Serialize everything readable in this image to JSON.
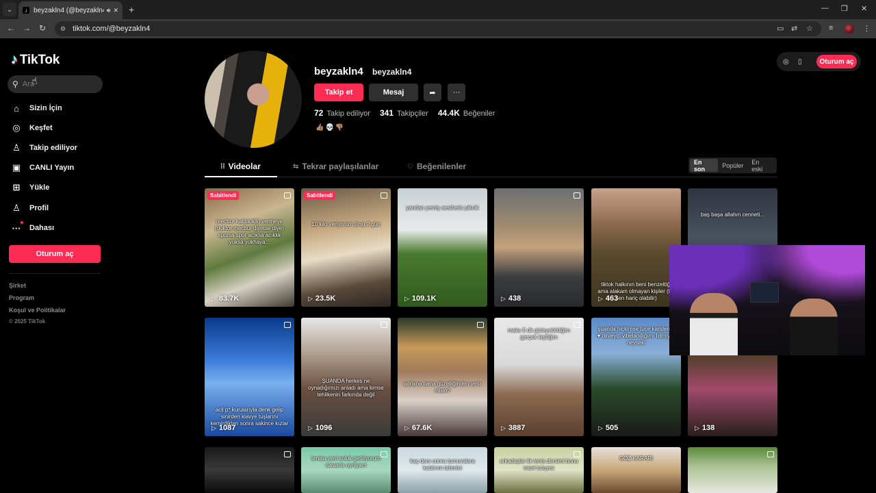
{
  "browser": {
    "tab_title": "beyzakln4 (@beyzakln4) | TikTok",
    "url": "tiktok.com/@beyzakln4",
    "tab_menu_icon": "chevron-down-icon",
    "new_tab": "+"
  },
  "sidebar": {
    "logo_text": "TikTok",
    "search_placeholder": "Ara",
    "items": [
      {
        "label": "Sizin İçin",
        "icon": "home-icon",
        "glyph": "⌂"
      },
      {
        "label": "Keşfet",
        "icon": "compass-icon",
        "glyph": "◎"
      },
      {
        "label": "Takip ediliyor",
        "icon": "following-icon",
        "glyph": "♙"
      },
      {
        "label": "CANLI Yayın",
        "icon": "live-icon",
        "glyph": "▣"
      },
      {
        "label": "Yükle",
        "icon": "upload-icon",
        "glyph": "⊞"
      },
      {
        "label": "Profil",
        "icon": "profile-icon",
        "glyph": "♙"
      },
      {
        "label": "Dahası",
        "icon": "more-icon",
        "glyph": "···"
      }
    ],
    "login_label": "Oturum aç",
    "footer": [
      "Şirket",
      "Program",
      "Koşul ve Politikalar"
    ],
    "copyright": "© 2025 TikTok"
  },
  "profile": {
    "username": "beyzakln4",
    "nickname": "beyzakln4",
    "follow_label": "Takip et",
    "message_label": "Mesaj",
    "stats": [
      {
        "value": "72",
        "label": "Takip ediliyor"
      },
      {
        "value": "341",
        "label": "Takipçiler"
      },
      {
        "value": "44.4K",
        "label": "Beğeniler"
      }
    ],
    "bio": "👍🏽💀👎🏽"
  },
  "top_right": {
    "login_label": "Oturum aç"
  },
  "tabs": [
    {
      "label": "Videolar",
      "icon": "grid-icon",
      "glyph": "⁞⁞"
    },
    {
      "label": "Tekrar paylaşılanlar",
      "icon": "repost-icon",
      "glyph": "⇆"
    },
    {
      "label": "Beğenilenler",
      "icon": "liked-icon",
      "glyph": "♡"
    }
  ],
  "sort": [
    "En son",
    "Popüler",
    "En eski"
  ],
  "pinned_label": "Sabitlendi",
  "videos": [
    {
      "views": "83.7K",
      "pinned": true,
      "caption": "mecbur kaldık kilo vermeye (doktor mecbur diyetse diye) sporsa spor acıksa acıkkk yoksa yokhaya... ",
      "bg": "linear-gradient(160deg,#8a6a46 0%,#c9b68f 30%,#5f7a3e 55%,#d7d1c3 75%,#3d3a30 100%)"
    },
    {
      "views": "23.5K",
      "pinned": true,
      "caption": "10 kilo veriyorum (ins) 2 gün",
      "bg": "linear-gradient(170deg,#6a5a48 0%,#c8ab82 35%,#e8dcc6 55%,#5a4a3a 80%,#2a2622 100%)"
    },
    {
      "views": "109.1K",
      "pinned": false,
      "caption": "yandan yemiş aesthetic piknik",
      "bg": "linear-gradient(180deg,#c8d0d4 0%,#e8eaea 35%,#4a7a2e 55%,#2f5a1e 100%)"
    },
    {
      "views": "438",
      "pinned": false,
      "caption": "",
      "bg": "linear-gradient(180deg,#6b6f73 0%,#9e8a70 30%,#c2a27c 50%,#3a3c40 75%,#2a2a2c 100%)"
    },
    {
      "views": "463",
      "pinned": false,
      "caption": "tiktok halkının beni benzettiği ama alakam olmayan kişiler (bu sen hariç olabilir)",
      "bg": "linear-gradient(180deg,#c8a28c 0%,#8c6a50 30%,#5a4a2e 55%,#3d3520 100%)"
    },
    {
      "views": "",
      "pinned": false,
      "caption": "baş başa allahın cenneti...",
      "bg": "linear-gradient(180deg,#2e3440 0%,#4a5260 40%,#1e2028 100%)"
    },
    {
      "views": "1087",
      "pinned": false,
      "caption": "acil p* kurularıyla denk gelip sinirden klavye tuşlarını kemirdikten sonra sakince kızlar",
      "bg": "linear-gradient(180deg,#0a3a8a 0%,#3a7ad8 35%,#7ab0f0 55%,#1a4aa0 100%)"
    },
    {
      "views": "1096",
      "pinned": false,
      "caption": "ŞUANDA herkes ne oynadığımızı anladı ama kimse tehlikenin farkında değil",
      "bg": "linear-gradient(180deg,#e8e8e8 0%,#b0a090 30%,#6a5040 60%,#3a3a3a 100%)"
    },
    {
      "views": "67.6K",
      "pinned": false,
      "caption": "adriana bana güzelliğinden verir misin?",
      "bg": "linear-gradient(180deg,#2a3a2a 0%,#c89a5a 25%,#a07a5a 45%,#d8d0c8 70%,#4a3a3a 100%)"
    },
    {
      "views": "3887",
      "pinned": false,
      "caption": "maks 5 dk gizleyebildiğim gerçek kişiliğim",
      "bg": "linear-gradient(180deg,#e8e8e8 0%,#d8d8d8 40%,#8a6a50 65%,#5a4030 100%)"
    },
    {
      "views": "505",
      "pinned": false,
      "caption": "şuanda hiçkimse tuce kandemir ♥ dinleyip vibelandığımı bilmiyor neyseki",
      "bg": "linear-gradient(180deg,#5a8ac8 0%,#8ab0d8 30%,#2a4a2a 60%,#1a1a1a 100%)"
    },
    {
      "views": "138",
      "pinned": false,
      "caption": "",
      "bg": "linear-gradient(180deg,#3a2a20 0%,#5a4030 35%,#a04a6a 60%,#2a2020 100%)"
    },
    {
      "views": "",
      "pinned": false,
      "caption": "",
      "bg": "linear-gradient(180deg,#1a1a1a 0%,#3a3a3a 50%,#0a0a0a 100%)"
    },
    {
      "views": "",
      "pinned": false,
      "caption": "tenisa yeni soluk getiriyorum salvarla oyniyam",
      "bg": "linear-gradient(180deg,#7ac8a8 0%,#a8d8c0 50%,#5a8a70 100%)"
    },
    {
      "views": "",
      "pinned": false,
      "caption": "kaç ders sonra turnuvalara katılırım tahmini",
      "bg": "linear-gradient(180deg,#c8d8e0 0%,#e0e8ec 50%,#8aa0a8 100%)"
    },
    {
      "views": "",
      "pinned": false,
      "caption": "arkadaşlar ilk tenis dersimi bonu nasıl tutuyoz",
      "bg": "linear-gradient(180deg,#c8d0a0 0%,#e0e4c8 50%,#6a7040 100%)"
    },
    {
      "views": "",
      "pinned": false,
      "caption": "GÖZ KARARI",
      "bg": "linear-gradient(180deg,#e8e0d8 0%,#c8a878 50%,#6a4a30 100%)"
    },
    {
      "views": "",
      "pinned": false,
      "caption": "",
      "bg": "linear-gradient(180deg,#5a8a3a 0%,#a8c090 40%,#e8e8e0 100%)"
    }
  ]
}
